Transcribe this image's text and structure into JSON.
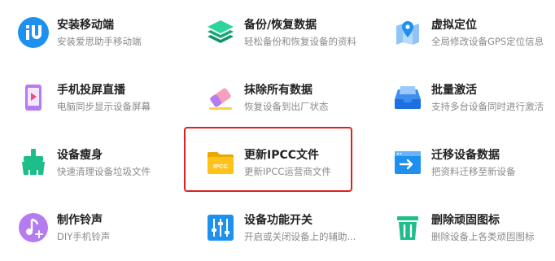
{
  "tiles": [
    {
      "title": "安装移动端",
      "sub": "安装爱思助手移动端",
      "icon": "iu-app-icon"
    },
    {
      "title": "备份/恢复数据",
      "sub": "轻松备份和恢复设备的资料",
      "icon": "layers-icon"
    },
    {
      "title": "虚拟定位",
      "sub": "全局修改设备GPS定位信息",
      "icon": "map-pin-icon"
    },
    {
      "title": "手机投屏直播",
      "sub": "电脑同步显示设备屏幕",
      "icon": "phone-play-icon"
    },
    {
      "title": "抹除所有数据",
      "sub": "恢复设备到出厂状态",
      "icon": "eraser-icon"
    },
    {
      "title": "批量激活",
      "sub": "支持多台设备同时进行激活",
      "icon": "inbox-icon"
    },
    {
      "title": "设备瘦身",
      "sub": "快速清理设备垃圾文件",
      "icon": "broom-icon"
    },
    {
      "title": "更新IPCC文件",
      "sub": "更新IPCC运营商文件",
      "icon": "ipcc-folder-icon",
      "badge": "IPCC"
    },
    {
      "title": "迁移设备数据",
      "sub": "把资料迁移至新设备",
      "icon": "migrate-icon"
    },
    {
      "title": "制作铃声",
      "sub": "DIY手机铃声",
      "icon": "music-note-icon"
    },
    {
      "title": "设备功能开关",
      "sub": "开启或关闭设备上的辅助...",
      "icon": "sliders-icon"
    },
    {
      "title": "删除顽固图标",
      "sub": "删除设备上各类顽固图标",
      "icon": "trash-icon"
    }
  ],
  "colors": {
    "blue": "#1E90F0",
    "green": "#1DBE8A",
    "yellow": "#FFC21A",
    "pink": "#F5A0BE",
    "purple": "#B57CF2"
  }
}
